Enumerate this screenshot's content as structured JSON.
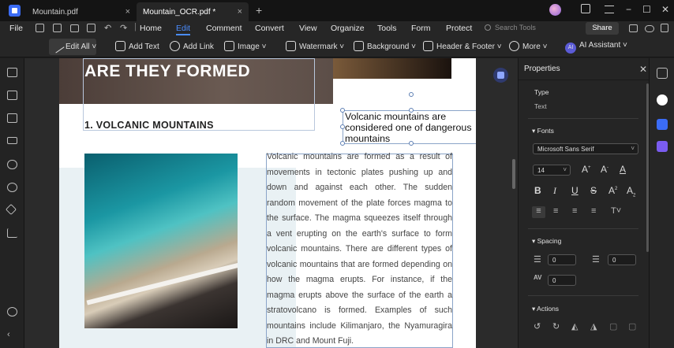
{
  "tabs": [
    {
      "label": "Mountain.pdf",
      "close": "×",
      "active": false
    },
    {
      "label": "Mountain_OCR.pdf *",
      "close": "×",
      "active": true
    }
  ],
  "window": {
    "new_tab": "+",
    "min": "−",
    "max": "☐",
    "close": "✕"
  },
  "menu": {
    "file": "File",
    "items": [
      "Home",
      "Edit",
      "Comment",
      "Convert",
      "View",
      "Organize",
      "Tools",
      "Form",
      "Protect"
    ],
    "active": "Edit",
    "search_placeholder": "Search Tools",
    "share": "Share"
  },
  "toolbar": {
    "edit_all": "Edit All",
    "add_text": "Add Text",
    "add_link": "Add Link",
    "image": "Image",
    "watermark": "Watermark",
    "background": "Background",
    "header_footer": "Header & Footer",
    "more": "More",
    "ai_badge": "AI",
    "ai_assistant": "AI Assistant"
  },
  "document": {
    "hero_title": "ARE THEY FORMED",
    "heading": "1. VOLCANIC MOUNTAINS",
    "callout": "Volcanic mountains are considered one of dangerous mountains",
    "body": "Volcanic mountains are formed as a result of movements in tectonic plates pushing up and down and against each other. The sudden random movement of the plate forces magma to the surface. The magma squeezes itself through a vent erupting on the earth's surface to form volcanic mountains. There are different types of volcanic mountains that are formed depending on how the magma erupts. For instance, if the magma erupts above the surface of the earth a stratovolcano is formed. Examples of such mountains include Kilimanjaro, the Nyamuragira in DRC and Mount Fuji."
  },
  "properties": {
    "title": "Properties",
    "type_label": "Type",
    "type_value": "Text",
    "fonts_label": "Fonts",
    "font_family": "Microsoft Sans Serif",
    "font_size": "14",
    "spacing_label": "Spacing",
    "line_spacing": "0",
    "para_spacing": "0",
    "char_spacing": "0",
    "actions_label": "Actions"
  },
  "colors": {
    "accent": "#4a8dff",
    "bg": "#1e1e1e",
    "panel": "#252525"
  }
}
